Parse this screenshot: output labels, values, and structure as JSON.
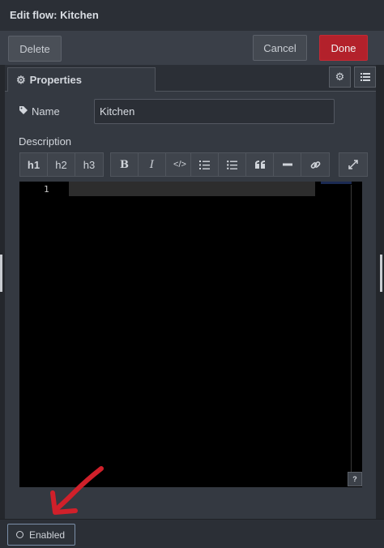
{
  "header": {
    "title": "Edit flow: Kitchen"
  },
  "actions": {
    "delete_label": "Delete",
    "cancel_label": "Cancel",
    "done_label": "Done"
  },
  "tabs": {
    "properties_label": "Properties"
  },
  "form": {
    "name_label": "Name",
    "name_value": "Kitchen",
    "description_label": "Description"
  },
  "toolbar": {
    "headings": [
      "h1",
      "h2",
      "h3"
    ],
    "bold": "B",
    "italic": "I",
    "code": "</>"
  },
  "editor": {
    "line_number": "1",
    "help_label": "?"
  },
  "footer": {
    "enabled_label": "Enabled"
  },
  "colors": {
    "done_button": "#b3212b",
    "annotation_arrow": "#d0202a"
  },
  "icons": [
    "cog-icon",
    "list-icon",
    "tag-icon",
    "ordered-list-icon",
    "unordered-list-icon",
    "quote-icon",
    "horizontal-rule-icon",
    "link-icon",
    "expand-icon"
  ]
}
